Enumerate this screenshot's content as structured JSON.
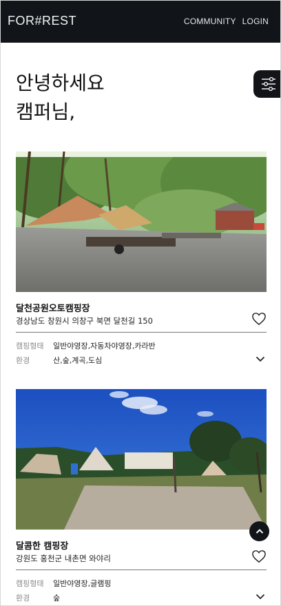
{
  "header": {
    "logo": "FOR#REST",
    "nav": [
      "COMMUNITY",
      "LOGIN"
    ]
  },
  "greeting": {
    "line1": "안녕하세요",
    "line2": "캠퍼님,"
  },
  "cards": [
    {
      "name": "달천공원오토캠핑장",
      "address": "경상남도 창원시 의창구 북면 달천길 150",
      "type_label": "캠핑형태",
      "type_value": "일반야영장,자동차야영장,카라반",
      "env_label": "환경",
      "env_value": "산,숲,계곡,도심"
    },
    {
      "name": "달콤한 캠핑장",
      "address": "강원도 홍천군 내촌면 와야리",
      "type_label": "캠핑형태",
      "type_value": "일반야영장,글램핑",
      "env_label": "환경",
      "env_value": "숲"
    }
  ],
  "icons": {
    "filter": "sliders-icon",
    "like": "heart-icon",
    "expand": "chevron-down-icon",
    "scroll_top": "chevron-up-icon"
  },
  "colors": {
    "header_bg": "#111418",
    "text": "#111111",
    "muted": "#8a8a8a"
  }
}
